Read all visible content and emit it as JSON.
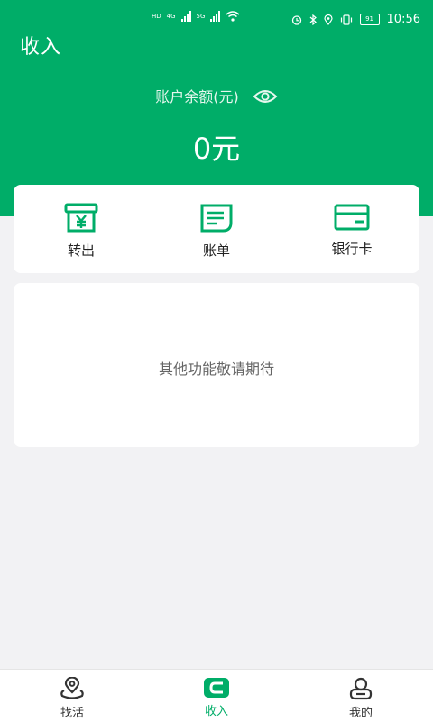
{
  "status_bar": {
    "network_left": "HD",
    "signal1_label": "4G",
    "signal2_label": "5G",
    "battery": "91",
    "time": "10:56",
    "icons": [
      "alarm-icon",
      "bluetooth-icon",
      "location-icon",
      "vibrate-icon"
    ]
  },
  "header": {
    "title": "收入",
    "balance_label": "账户余额(元)",
    "balance_value": "0元"
  },
  "actions": [
    {
      "label": "转出",
      "icon": "withdraw-icon"
    },
    {
      "label": "账单",
      "icon": "bill-icon"
    },
    {
      "label": "银行卡",
      "icon": "bank-card-icon"
    }
  ],
  "info": {
    "message": "其他功能敬请期待"
  },
  "tabs": [
    {
      "label": "找活",
      "icon": "location-pin-icon",
      "active": false
    },
    {
      "label": "收入",
      "icon": "wallet-icon",
      "active": true
    },
    {
      "label": "我的",
      "icon": "profile-icon",
      "active": false
    }
  ],
  "colors": {
    "primary": "#00ad68",
    "background": "#f2f2f4"
  }
}
